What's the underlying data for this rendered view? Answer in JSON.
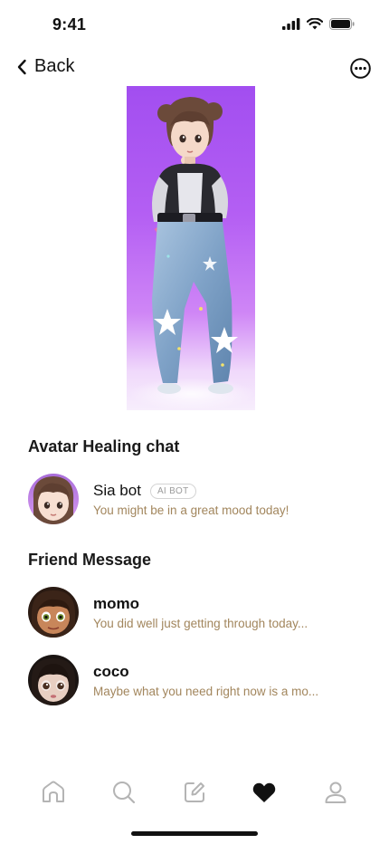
{
  "status_bar": {
    "time": "9:41"
  },
  "nav": {
    "back_label": "Back"
  },
  "icons": {
    "back": "chevron-left-icon",
    "more": "more-circle-icon",
    "tabs": [
      "home-icon",
      "search-icon",
      "edit-icon",
      "heart-icon",
      "profile-icon"
    ]
  },
  "avatar_section": {
    "title": "Avatar Healing chat"
  },
  "ai_chat": {
    "name": "Sia bot",
    "badge": "AI BOT",
    "preview": "You might be in a great mood today!"
  },
  "friend_section": {
    "title": "Friend Message"
  },
  "friends": [
    {
      "name": "momo",
      "preview": "You did well just getting through today..."
    },
    {
      "name": "coco",
      "preview": "Maybe what you need right now is a mo..."
    }
  ],
  "colors": {
    "accent_preview": "#a2865d",
    "hero_purple": "#a24ef0",
    "active_tab": "#111111",
    "inactive_tab": "#b4b4b4"
  },
  "tab_bar": {
    "active_index": 3
  }
}
